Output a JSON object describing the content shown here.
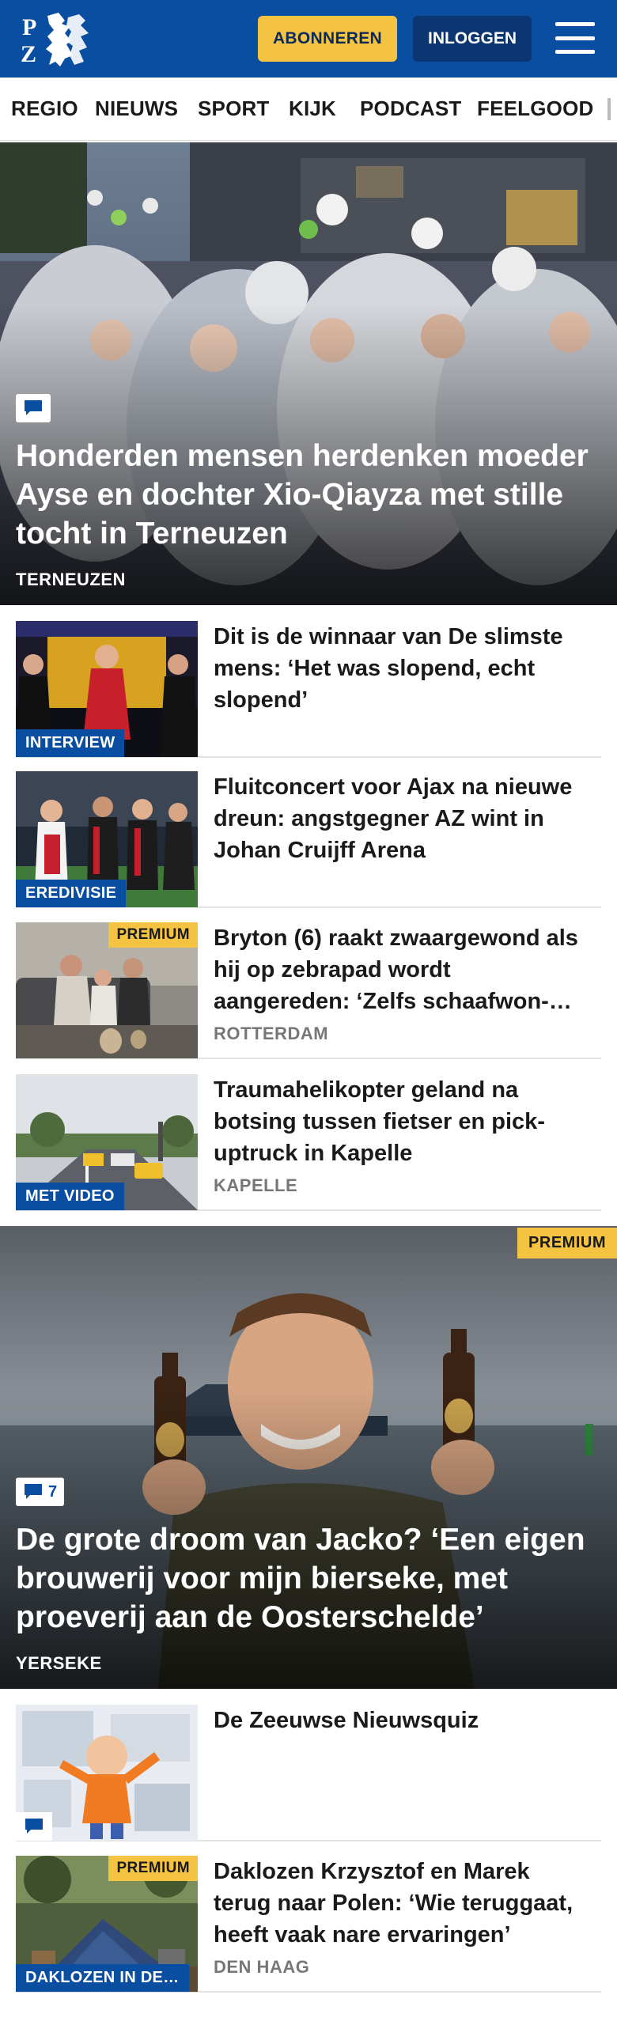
{
  "header": {
    "logo_text": "PZC",
    "subscribe_label": "ABONNEREN",
    "login_label": "INLOGGEN",
    "menu_icon": "hamburger-menu-icon"
  },
  "nav": {
    "items": [
      "REGIO",
      "NIEUWS",
      "SPORT",
      "KIJK",
      "PODCAST",
      "FEELGOOD"
    ]
  },
  "hero1": {
    "title": "Honderden mensen herdenken moeder Ayse en dochter Xio-Qiayza met stille tocht in Terneuzen",
    "location": "TERNEUZEN",
    "comment_icon": "comment-icon"
  },
  "articles1": [
    {
      "title": "Dit is de winnaar van De slimste mens: ‘Het was slopend, echt slopend’",
      "label": "INTERVIEW",
      "location": ""
    },
    {
      "title": "Fluitconcert voor Ajax na nieuwe dreun: angstgegner AZ wint in Johan Cruijff Arena",
      "label": "EREDIVISIE",
      "location": ""
    },
    {
      "title": "Bryton (6) raakt zwaargewond als hij op zebrapad wordt aangereden: ‘Zelfs schaafwon-…",
      "premium": "PREMIUM",
      "location": "ROTTERDAM"
    },
    {
      "title": "Traumahelikopter geland na botsing tussen fietser en pick-uptruck in Kapelle",
      "label": "MET VIDEO",
      "location": "KAPELLE"
    }
  ],
  "hero2": {
    "title": "De grote droom van Jacko? ‘Een eigen brouwerij voor mijn bierseke, met proeverij aan de Oosterschelde’",
    "location": "YERSEKE",
    "premium": "PREMIUM",
    "comment_count": "7"
  },
  "articles2": [
    {
      "title": "De Zeeuwse Nieuwsquiz",
      "location": ""
    },
    {
      "title": "Daklozen Krzysztof en Marek terug naar Polen: ‘Wie teruggaat, heeft vaak nare ervaringen’",
      "label": "DAKLOZEN IN DE…",
      "premium": "PREMIUM",
      "location": "DEN HAAG"
    }
  ],
  "colors": {
    "brand_blue": "#0a4ea2",
    "subscribe_yellow": "#f5c342",
    "login_navy": "#0b3672"
  }
}
